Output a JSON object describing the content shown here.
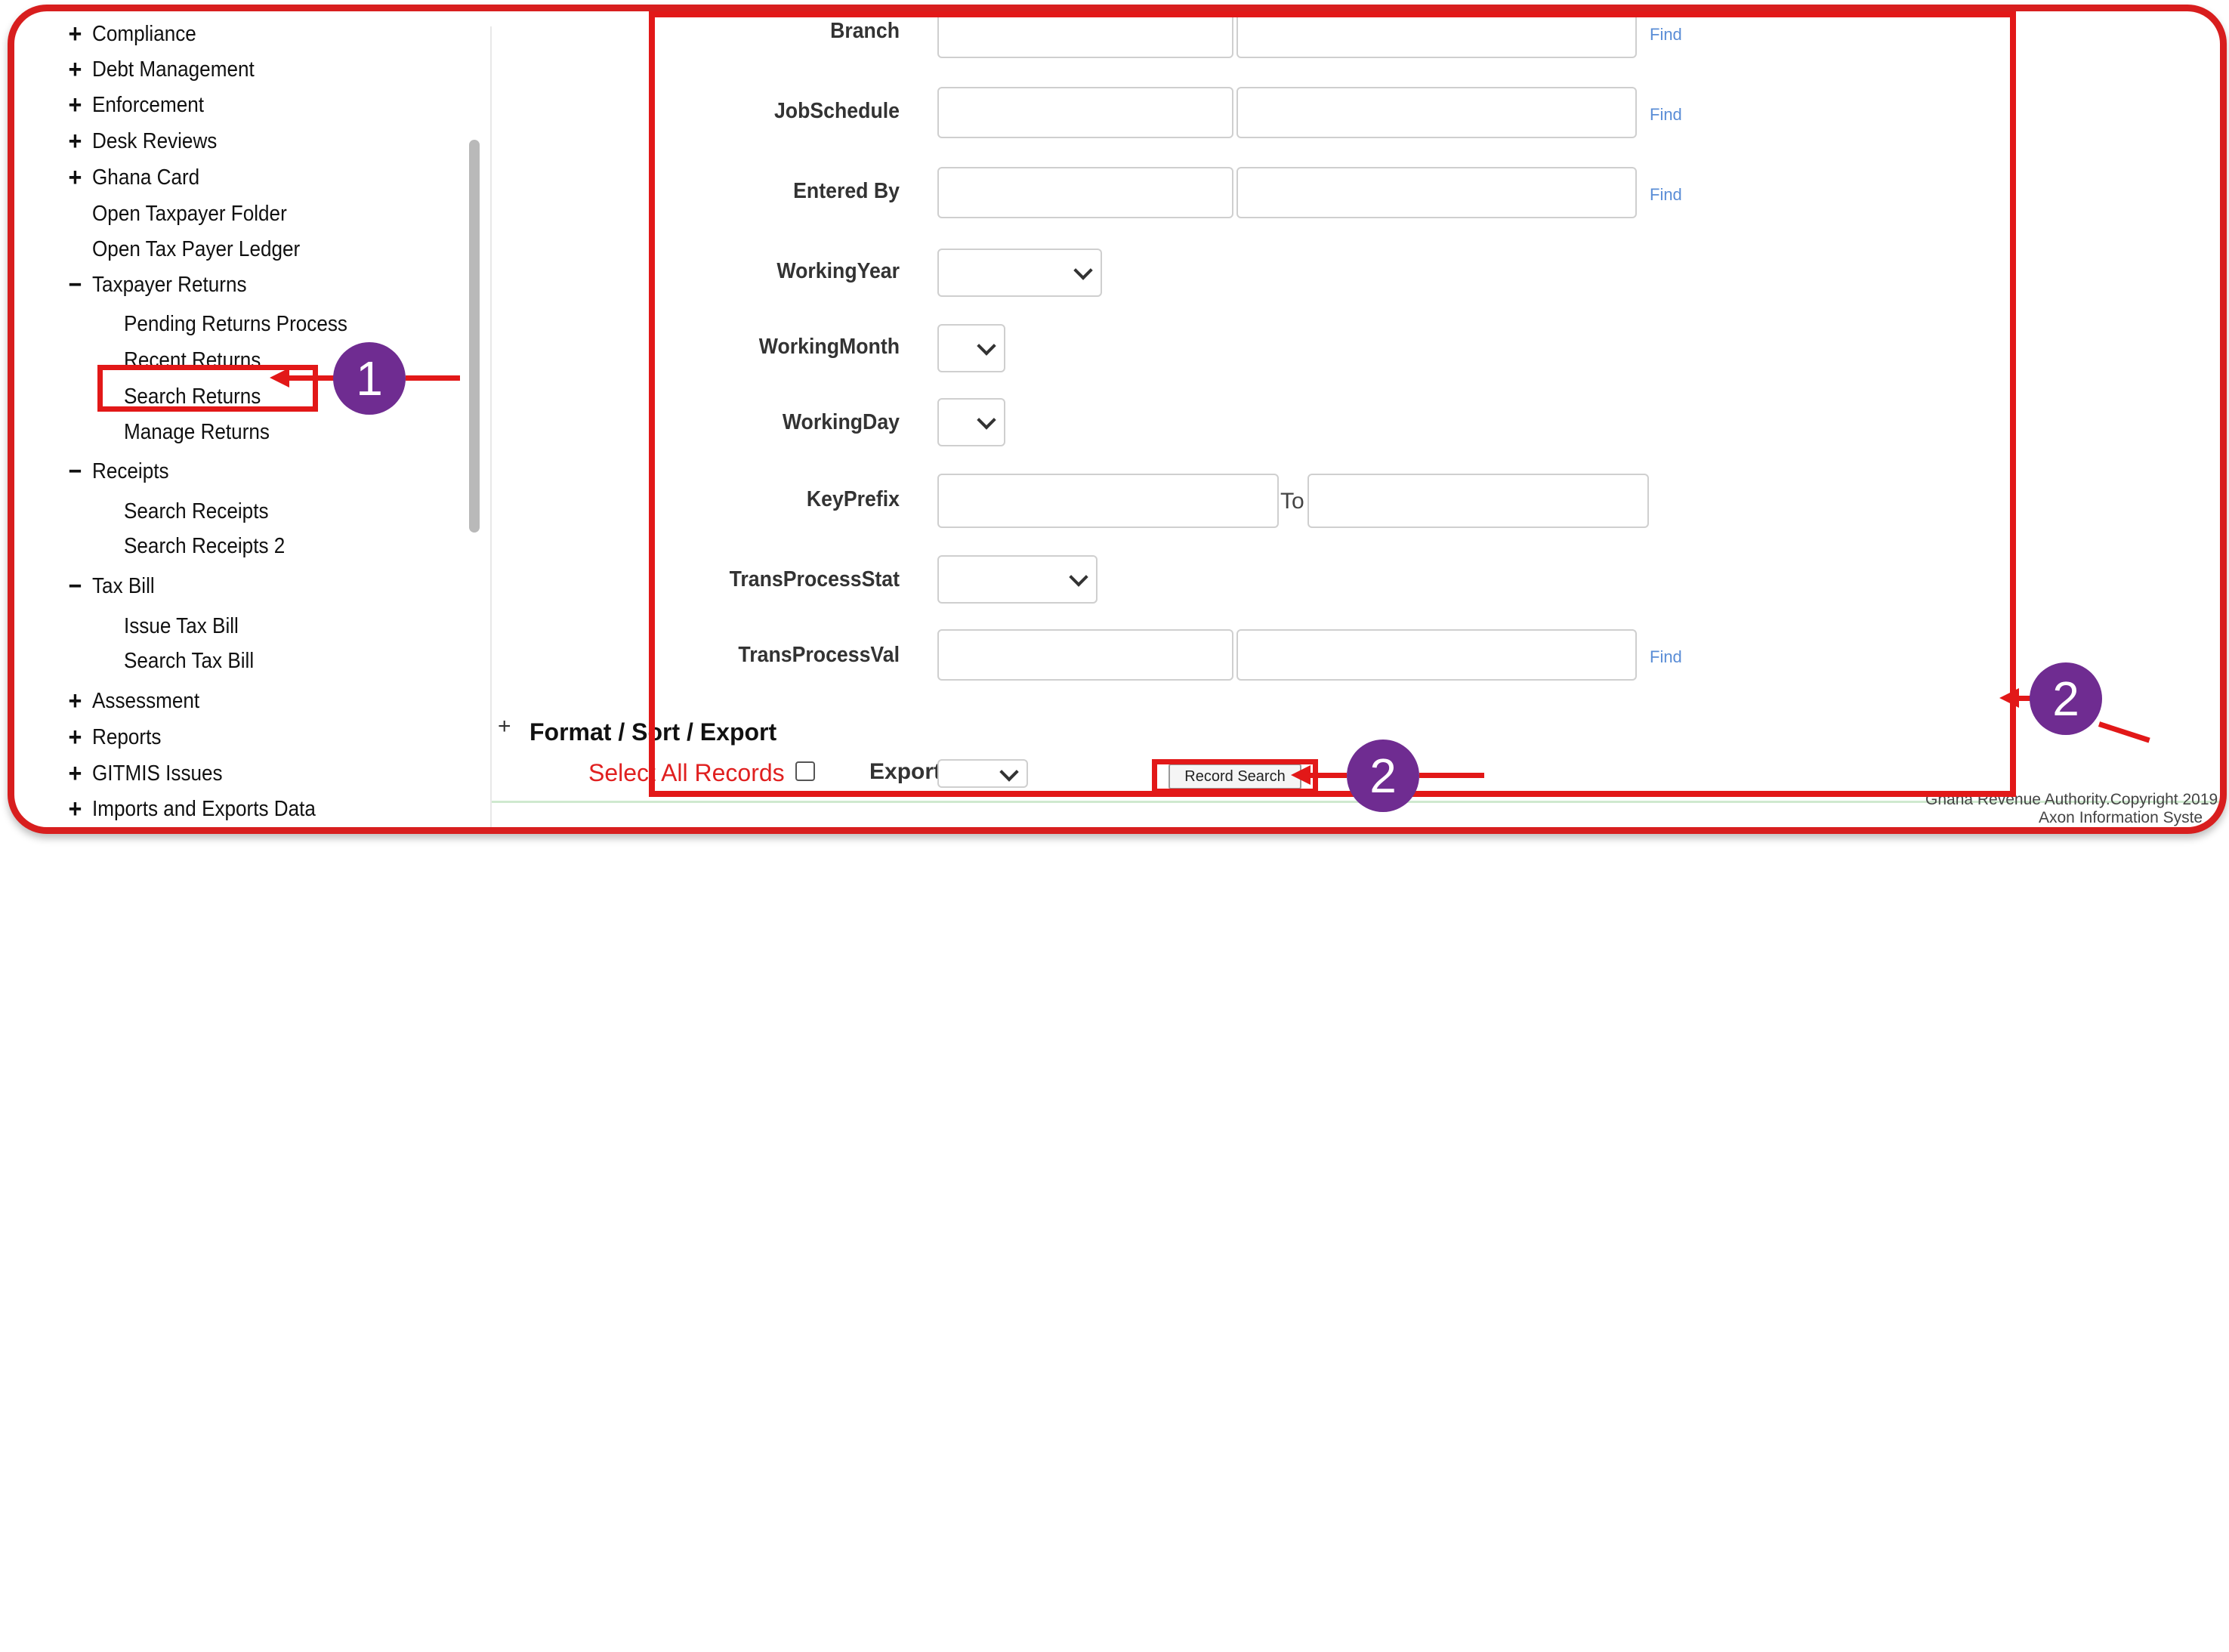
{
  "sidebar": {
    "items": [
      {
        "sign": "+",
        "label": "Compliance"
      },
      {
        "sign": "+",
        "label": "Debt Management"
      },
      {
        "sign": "+",
        "label": "Enforcement"
      },
      {
        "sign": "+",
        "label": "Desk Reviews"
      },
      {
        "sign": "+",
        "label": "Ghana Card"
      },
      {
        "sign": "",
        "label": "Open Taxpayer Folder"
      },
      {
        "sign": "",
        "label": "Open Tax Payer Ledger"
      },
      {
        "sign": "−",
        "label": "Taxpayer Returns"
      },
      {
        "sign": "",
        "label": "Pending Returns Process"
      },
      {
        "sign": "",
        "label": "Recent Returns"
      },
      {
        "sign": "",
        "label": "Search Returns"
      },
      {
        "sign": "",
        "label": "Manage Returns"
      },
      {
        "sign": "−",
        "label": "Receipts"
      },
      {
        "sign": "",
        "label": "Search Receipts"
      },
      {
        "sign": "",
        "label": "Search Receipts 2"
      },
      {
        "sign": "−",
        "label": "Tax Bill"
      },
      {
        "sign": "",
        "label": "Issue Tax Bill"
      },
      {
        "sign": "",
        "label": "Search Tax Bill"
      },
      {
        "sign": "+",
        "label": "Assessment"
      },
      {
        "sign": "+",
        "label": "Reports"
      },
      {
        "sign": "+",
        "label": "GITMIS Issues"
      },
      {
        "sign": "+",
        "label": "Imports and Exports Data"
      }
    ]
  },
  "form": {
    "fields": [
      {
        "label": "Branch",
        "find": "Find"
      },
      {
        "label": "JobSchedule",
        "find": "Find"
      },
      {
        "label": "Entered By",
        "find": "Find"
      },
      {
        "label": "WorkingYear"
      },
      {
        "label": "WorkingMonth"
      },
      {
        "label": "WorkingDay"
      },
      {
        "label": "KeyPrefix",
        "to": "To"
      },
      {
        "label": "TransProcessStat"
      },
      {
        "label": "TransProcessVal",
        "find": "Find"
      }
    ]
  },
  "format_section": {
    "toggle": "+",
    "title": "Format / Sort / Export",
    "select_all": "Select All Records",
    "export_label": "Export",
    "record_search": "Record Search"
  },
  "footer": {
    "line1": "Ghana Revenue Authority.Copyright 2019",
    "line2": "Axon Information Syste"
  },
  "annotations": {
    "badge1": "1",
    "badge2a": "2",
    "badge2b": "2"
  },
  "colors": {
    "highlight": "#e21818",
    "badge": "#6f2c91",
    "find_link": "#5a8dd6",
    "select_all": "#e02020"
  }
}
